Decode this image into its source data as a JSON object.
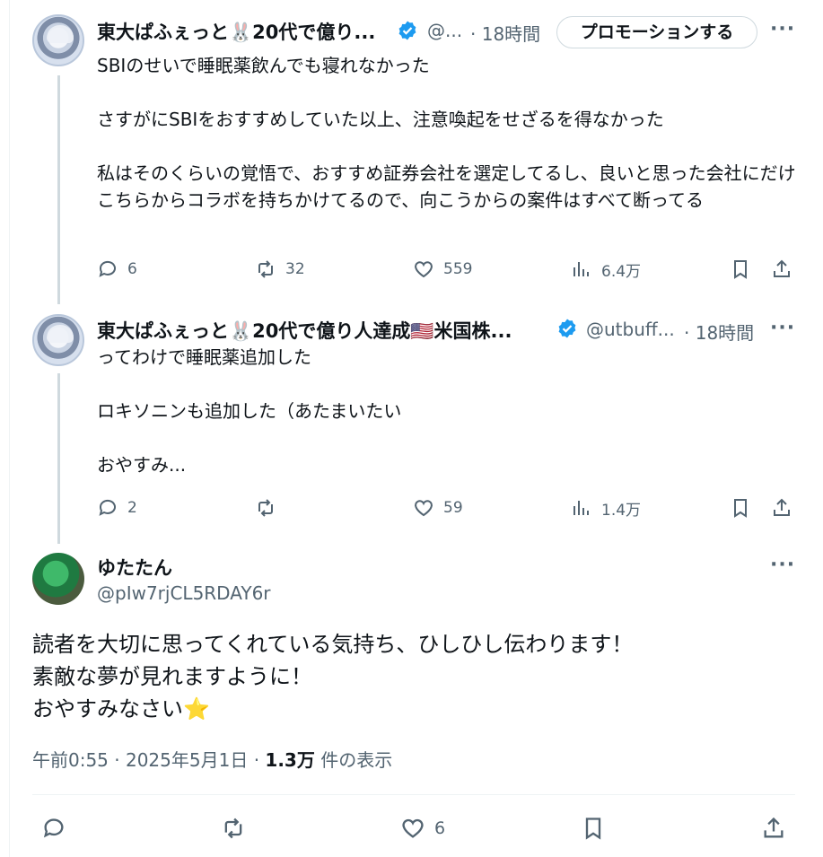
{
  "post1": {
    "display_name": "東大ぱふぇっと🐰20代で億り...",
    "handle": "@...",
    "time": "· 18時間",
    "promote_label": "プロモーションする",
    "more": "···",
    "text": "SBIのせいで睡眠薬飲んでも寝れなかった\n\nさすがにSBIをおすすめしていた以上、注意喚起をせざるを得なかった\n\n私はそのくらいの覚悟で、おすすめ証券会社を選定してるし、良いと思った会社にだけこちらからコラボを持ちかけてるので、向こうからの案件はすべて断ってる",
    "replies": "6",
    "reposts": "32",
    "likes": "559",
    "views": "6.4万"
  },
  "post2": {
    "display_name": "東大ぱふぇっと🐰20代で億り人達成🇺🇸米国株...",
    "handle": "@utbuff...",
    "time": "· 18時間",
    "more": "···",
    "text": "ってわけで睡眠薬追加した\n\nロキソニンも追加した（あたまいたい\n\nおやすみ...",
    "replies": "2",
    "reposts": "",
    "likes": "59",
    "views": "1.4万"
  },
  "main_post": {
    "display_name": "ゆたたん",
    "handle": "@pIw7rjCL5RDAY6r",
    "more": "···",
    "text": "読者を大切に思ってくれている気持ち、ひしひし伝わります！\n素敵な夢が見れますように！\nおやすみなさい⭐",
    "timestamp": "午前0:55 · 2025年5月1日 · ",
    "views_count": "1.3万",
    "views_label": " 件の表示",
    "likes": "6"
  },
  "colors": {
    "verified": "#1d9bf0",
    "secondary_text": "#536471",
    "thread_line": "#cfd9de"
  },
  "icons": [
    "reply-icon",
    "repost-icon",
    "like-icon",
    "views-icon",
    "bookmark-icon",
    "share-icon",
    "verified-badge-icon",
    "more-icon"
  ]
}
